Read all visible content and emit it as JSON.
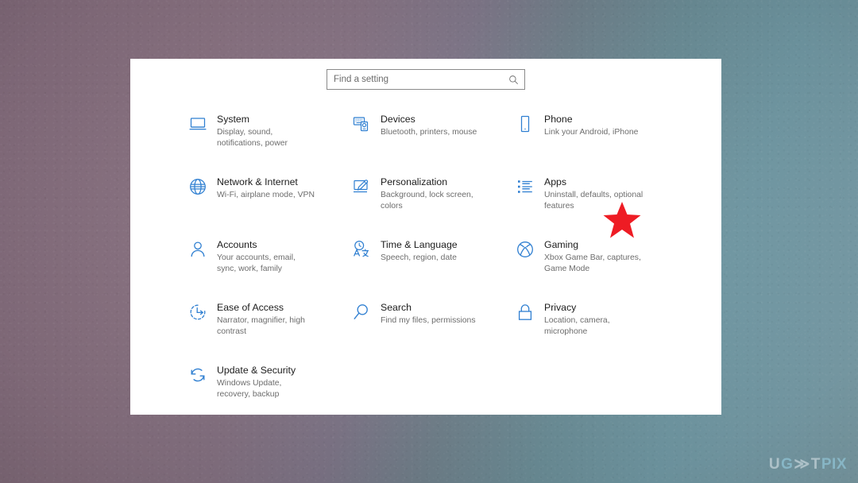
{
  "desktop": {
    "background_left_color": "#8d7585",
    "background_right_color": "#7ba1b0"
  },
  "watermark": {
    "text_start": "U",
    "text_accent": "G",
    "text_mark": "≫",
    "text_mid": "T",
    "text_end": "PIX",
    "full": "UGETFIX"
  },
  "window": {
    "background_color": "#ffffff"
  },
  "search": {
    "value": "",
    "placeholder": "Find a setting",
    "icon": "search-icon"
  },
  "annotation": {
    "type": "star-marker",
    "color": "#ee1c24",
    "points": 5,
    "target": "Apps"
  },
  "settings": {
    "items": [
      {
        "id": "system",
        "icon": "monitor-icon",
        "title": "System",
        "desc": "Display, sound, notifications, power"
      },
      {
        "id": "devices",
        "icon": "devices-icon",
        "title": "Devices",
        "desc": "Bluetooth, printers, mouse"
      },
      {
        "id": "phone",
        "icon": "phone-icon",
        "title": "Phone",
        "desc": "Link your Android, iPhone"
      },
      {
        "id": "network-internet",
        "icon": "globe-icon",
        "title": "Network & Internet",
        "desc": "Wi-Fi, airplane mode, VPN"
      },
      {
        "id": "personalization",
        "icon": "paintbrush-monitor-icon",
        "title": "Personalization",
        "desc": "Background, lock screen, colors"
      },
      {
        "id": "apps",
        "icon": "app-list-icon",
        "title": "Apps",
        "desc": "Uninstall, defaults, optional features"
      },
      {
        "id": "accounts",
        "icon": "person-icon",
        "title": "Accounts",
        "desc": "Your accounts, email, sync, work, family"
      },
      {
        "id": "time-language",
        "icon": "clock-language-icon",
        "title": "Time & Language",
        "desc": "Speech, region, date"
      },
      {
        "id": "gaming",
        "icon": "xbox-icon",
        "title": "Gaming",
        "desc": "Xbox Game Bar, captures, Game Mode"
      },
      {
        "id": "ease-of-access",
        "icon": "ease-of-access-icon",
        "title": "Ease of Access",
        "desc": "Narrator, magnifier, high contrast"
      },
      {
        "id": "search",
        "icon": "magnifier-icon",
        "title": "Search",
        "desc": "Find my files, permissions"
      },
      {
        "id": "privacy",
        "icon": "lock-icon",
        "title": "Privacy",
        "desc": "Location, camera, microphone"
      },
      {
        "id": "update-security",
        "icon": "refresh-icon",
        "title": "Update & Security",
        "desc": "Windows Update, recovery, backup"
      }
    ]
  }
}
